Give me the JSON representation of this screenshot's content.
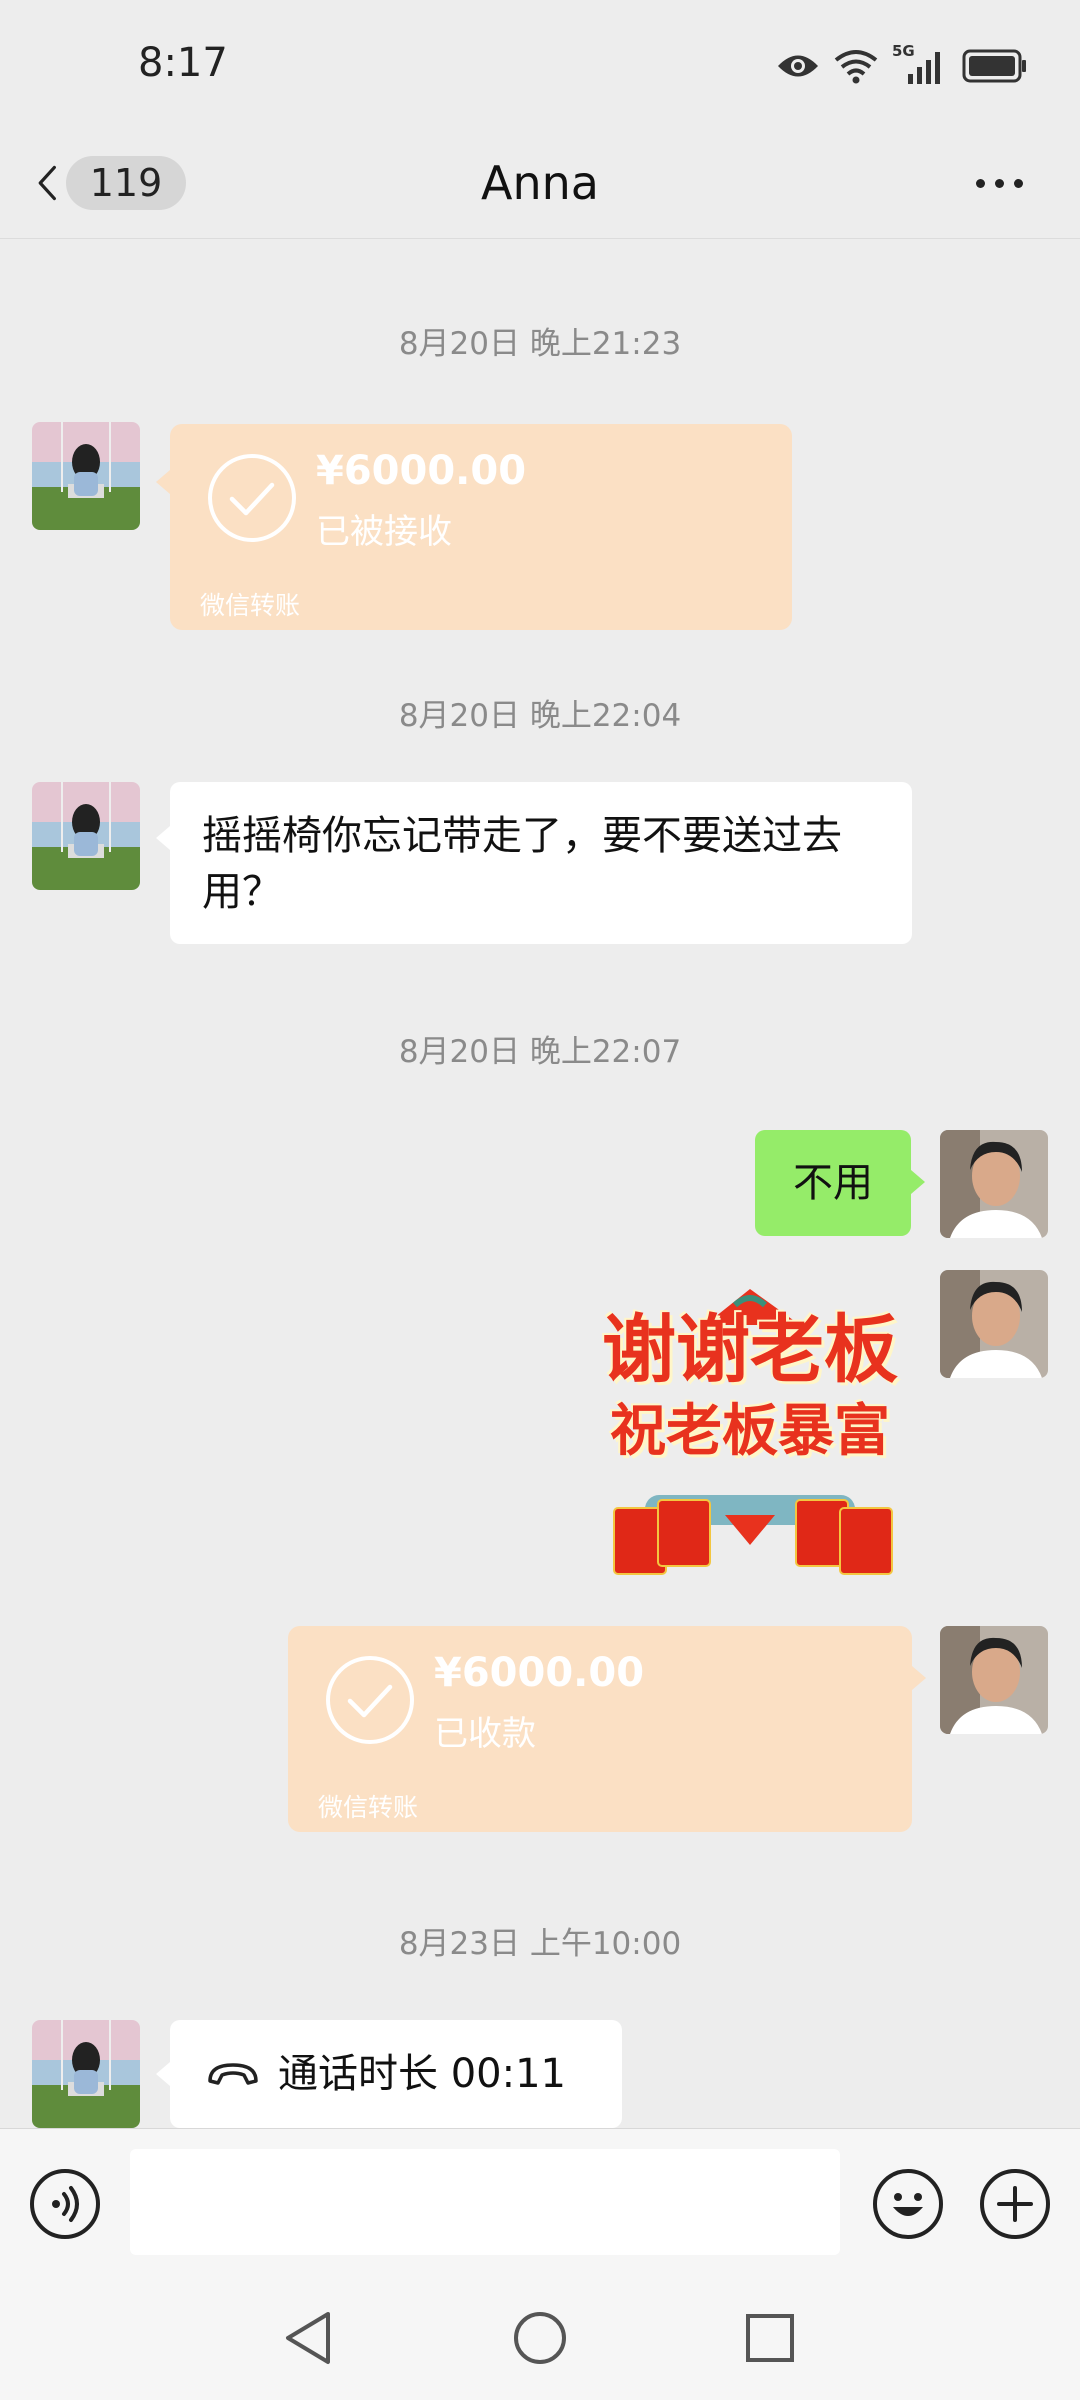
{
  "status_bar": {
    "time": "8:17",
    "network": "5G",
    "icons": [
      "eye-icon",
      "wifi-icon",
      "signal-icon",
      "battery-icon"
    ]
  },
  "nav": {
    "back_icon": "chevron-left-icon",
    "unread_count": "119",
    "title": "Anna",
    "more_icon": "more-icon"
  },
  "messages": [
    {
      "kind": "timestamp",
      "text": "8月20日 晚上21:23"
    },
    {
      "kind": "transfer",
      "side": "left",
      "amount": "¥6000.00",
      "status": "已被接收",
      "footer": "微信转账"
    },
    {
      "kind": "timestamp",
      "text": "8月20日 晚上22:04"
    },
    {
      "kind": "text",
      "side": "left",
      "text": "摇摇椅你忘记带走了，要不要送过去用？"
    },
    {
      "kind": "timestamp",
      "text": "8月20日 晚上22:07"
    },
    {
      "kind": "text",
      "side": "right",
      "text": "不用"
    },
    {
      "kind": "sticker",
      "side": "right",
      "line1": "谢谢老板",
      "line2": "祝老板暴富"
    },
    {
      "kind": "transfer",
      "side": "right",
      "amount": "¥6000.00",
      "status": "已收款",
      "footer": "微信转账"
    },
    {
      "kind": "timestamp",
      "text": "8月23日 上午10:00"
    },
    {
      "kind": "call",
      "side": "left",
      "text": "通话时长 00:11"
    }
  ],
  "input_bar": {
    "voice_icon": "voice-icon",
    "input_value": "",
    "emoji_icon": "emoji-icon",
    "plus_icon": "plus-icon"
  },
  "system_nav": [
    "back-triangle-icon",
    "home-circle-icon",
    "recents-square-icon"
  ],
  "colors": {
    "background": "#ededed",
    "bubble_green": "#95ec69",
    "transfer_orange": "#fbe0c4",
    "sticker_red": "#e8321e"
  }
}
